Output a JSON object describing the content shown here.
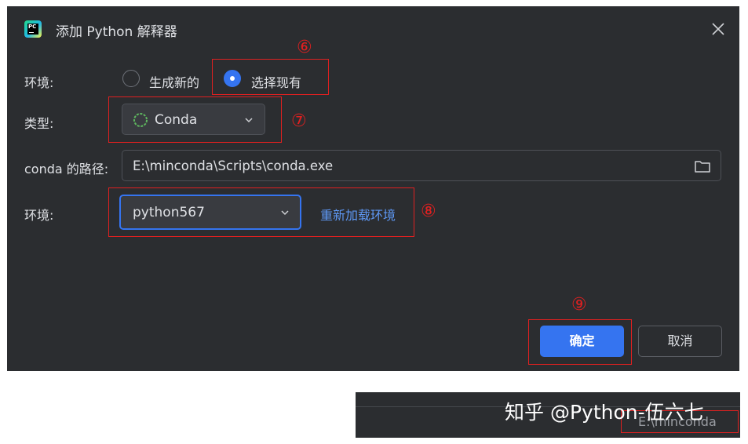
{
  "dialog": {
    "title": "添加 Python 解释器",
    "app_icon_text": "PC"
  },
  "environment_mode": {
    "label": "环境:",
    "option_new": "生成新的",
    "option_existing": "选择现有",
    "selected": "选择现有"
  },
  "type": {
    "label": "类型:",
    "value": "Conda"
  },
  "conda_path": {
    "label": "conda 的路径:",
    "value": "E:\\minconda\\Scripts\\conda.exe"
  },
  "environment": {
    "label": "环境:",
    "value": "python567",
    "reload_link": "重新加载环境"
  },
  "buttons": {
    "ok": "确定",
    "cancel": "取消"
  },
  "annotations": {
    "n6": "⑥",
    "n7": "⑦",
    "n8": "⑧",
    "n9": "⑨"
  },
  "footer": {
    "watermark": "知乎 @Python-伍六七",
    "path_fragment": "E:\\minconda"
  },
  "colors": {
    "dialog_bg": "#2b2d30",
    "accent": "#3574f0",
    "link": "#5e98f5",
    "annotation": "#e02020",
    "conda_icon": "#5fb85f"
  }
}
